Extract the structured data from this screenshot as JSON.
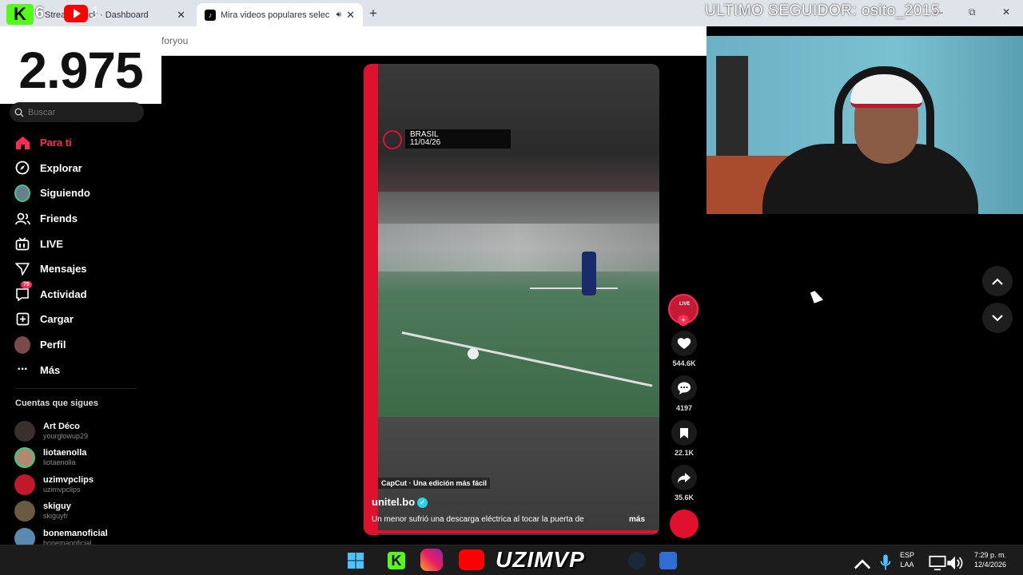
{
  "browser": {
    "tabs": [
      {
        "title": "Stream · Kick · Dashboard",
        "close": "✕"
      },
      {
        "title": "Mira videos populares selec",
        "close": "✕"
      }
    ],
    "new_tab": "+",
    "address": "foryou",
    "window_controls": [
      "—",
      "⧉",
      "✕"
    ]
  },
  "overlay": {
    "kick_count": "6",
    "youtube_count": "1",
    "counter_value": "2.975",
    "last_follower": "ULTIMO SEGUIDOR: osito_2015"
  },
  "search": {
    "placeholder": "Buscar"
  },
  "nav": [
    {
      "label": "Para ti",
      "icon": "home-icon"
    },
    {
      "label": "Explorar",
      "icon": "compass-icon"
    },
    {
      "label": "Siguiendo",
      "icon": "avatar-icon"
    },
    {
      "label": "Friends",
      "icon": "friends-icon"
    },
    {
      "label": "LIVE",
      "icon": "live-icon"
    },
    {
      "label": "Mensajes",
      "icon": "messages-icon"
    },
    {
      "label": "Actividad",
      "icon": "activity-icon",
      "badge": "75"
    },
    {
      "label": "Cargar",
      "icon": "upload-icon"
    },
    {
      "label": "Perfil",
      "icon": "profile-icon"
    },
    {
      "label": "Más",
      "icon": "more-icon"
    }
  ],
  "following": {
    "title": "Cuentas que sigues",
    "accounts": [
      {
        "name": "Art Déco",
        "user": "yourglowup29"
      },
      {
        "name": "liotaenolla",
        "user": "liotaenolla"
      },
      {
        "name": "uzimvpclips",
        "user": "uzimvpclips"
      },
      {
        "name": "skiguy",
        "user": "skiguyfr"
      },
      {
        "name": "bonemanoficial",
        "user": "bonemanoficial"
      }
    ]
  },
  "video": {
    "location": "BRASIL",
    "date": "11/04/26",
    "capcut": "CapCut · Una edición más fácil",
    "author": "unitel.bo",
    "description": "Un menor sufrió una descarga eléctrica al tocar la puerta de",
    "more": "más"
  },
  "actions": {
    "live_label": "LIVE",
    "likes": "544.6K",
    "comments": "4197",
    "saves": "22.1K",
    "shares": "35.6K"
  },
  "taskbar": {
    "brand": "UZIMVP",
    "lang_top": "ESP",
    "lang_bottom": "LAA",
    "time": "7:29 p. m.",
    "date": "12/4/2026"
  },
  "colors": {
    "accent": "#fe2c55",
    "kick": "#53fc18",
    "youtube": "#ff0000",
    "video_red": "#e0102f"
  }
}
